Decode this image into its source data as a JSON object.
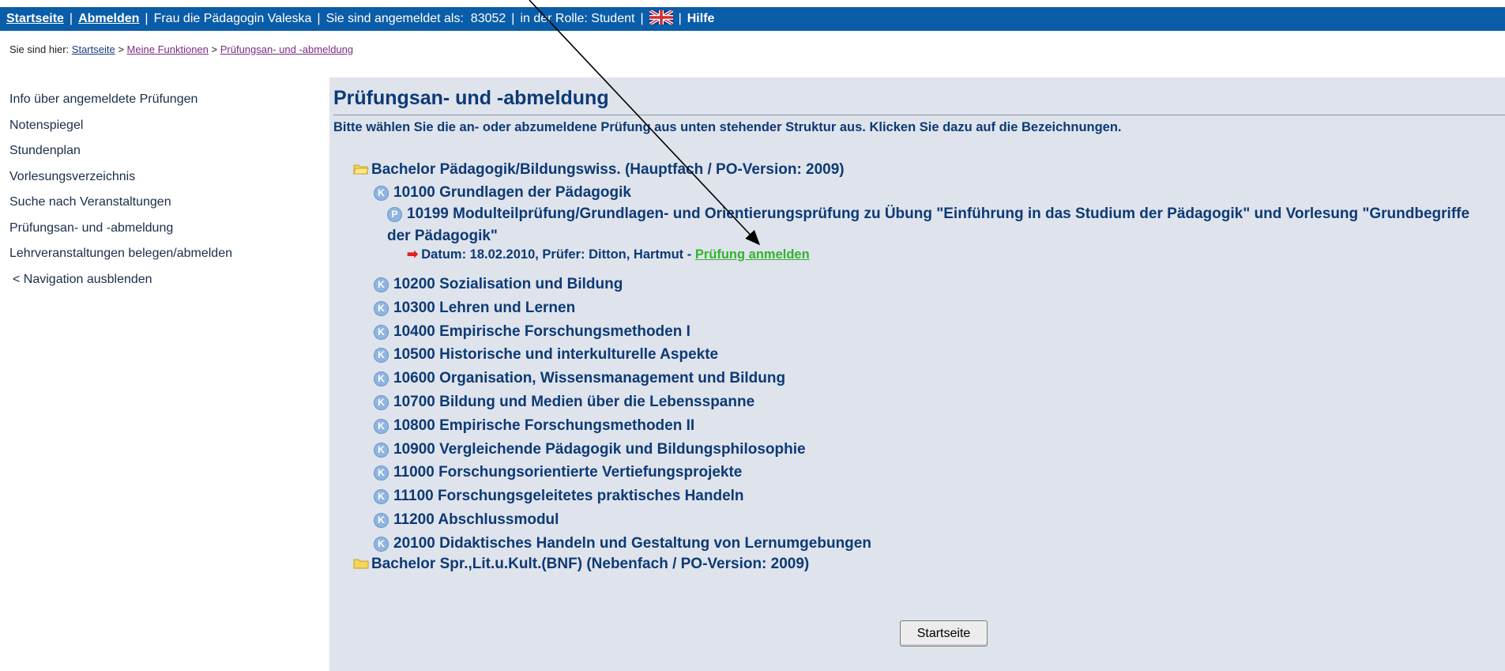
{
  "topbar": {
    "home_label": "Startseite",
    "logout_label": "Abmelden",
    "user_name": "Frau die Pädagogin Valeska",
    "logged_in_as": "Sie sind angemeldet als:",
    "user_id": "83052",
    "role": "in der Rolle: Student",
    "help_label": "Hilfe",
    "flag_icon": "uk-flag-icon",
    "bg_color": "#0a5da8"
  },
  "breadcrumb": {
    "prefix": "Sie sind hier:",
    "items": [
      "Startseite",
      "Meine Funktionen",
      "Prüfungsan- und -abmeldung"
    ],
    "separator": ">"
  },
  "sidebar": {
    "items": [
      "Info über angemeldete Prüfungen",
      "Notenspiegel",
      "Stundenplan",
      "Vorlesungsverzeichnis",
      "Suche nach Veranstaltungen",
      "Prüfungsan- und -abmeldung",
      "Lehrveranstaltungen belegen/abmelden",
      "< Navigation ausblenden"
    ]
  },
  "main": {
    "title": "Prüfungsan- und -abmeldung",
    "instruction": "Bitte wählen Sie die an- oder abzumeldene Prüfung aus unten stehender Struktur aus. Klicken Sie dazu auf die Bezeichnungen.",
    "root1": "Bachelor Pädagogik/Bildungswiss. (Hauptfach / PO-Version: 2009)",
    "module_first": "10100 Grundlagen der Pädagogik",
    "exam": "10199 Modulteilprüfung/Grundlagen- und Orientierungsprüfung zu Übung \"Einführung in das Studium der Pädagogik\" und Vorlesung \"Grundbegriffe der Pädagogik\"",
    "exam_details": "Datum: 18.02.2010, Prüfer: Ditton, Hartmut -",
    "register_link": "Prüfung anmelden",
    "modules": [
      "10200 Sozialisation und Bildung",
      "10300 Lehren und Lernen",
      "10400 Empirische Forschungsmethoden I",
      "10500 Historische und interkulturelle Aspekte",
      "10600 Organisation, Wissensmanagement und Bildung",
      "10700 Bildung und Medien über die Lebensspanne",
      "10800 Empirische Forschungsmethoden II",
      "10900 Vergleichende Pädagogik und Bildungsphilosophie",
      "11000 Forschungsorientierte Vertiefungsprojekte",
      "11100 Forschungsgeleitetes praktisches Handeln",
      "11200 Abschlussmodul",
      "20100 Didaktisches Handeln und Gestaltung von Lernumgebungen"
    ],
    "root2": "Bachelor Spr.,Lit.u.Kult.(BNF) (Nebenfach / PO-Version: 2009)",
    "k_badge": "K",
    "p_badge": "P",
    "button_label": "Startseite"
  }
}
